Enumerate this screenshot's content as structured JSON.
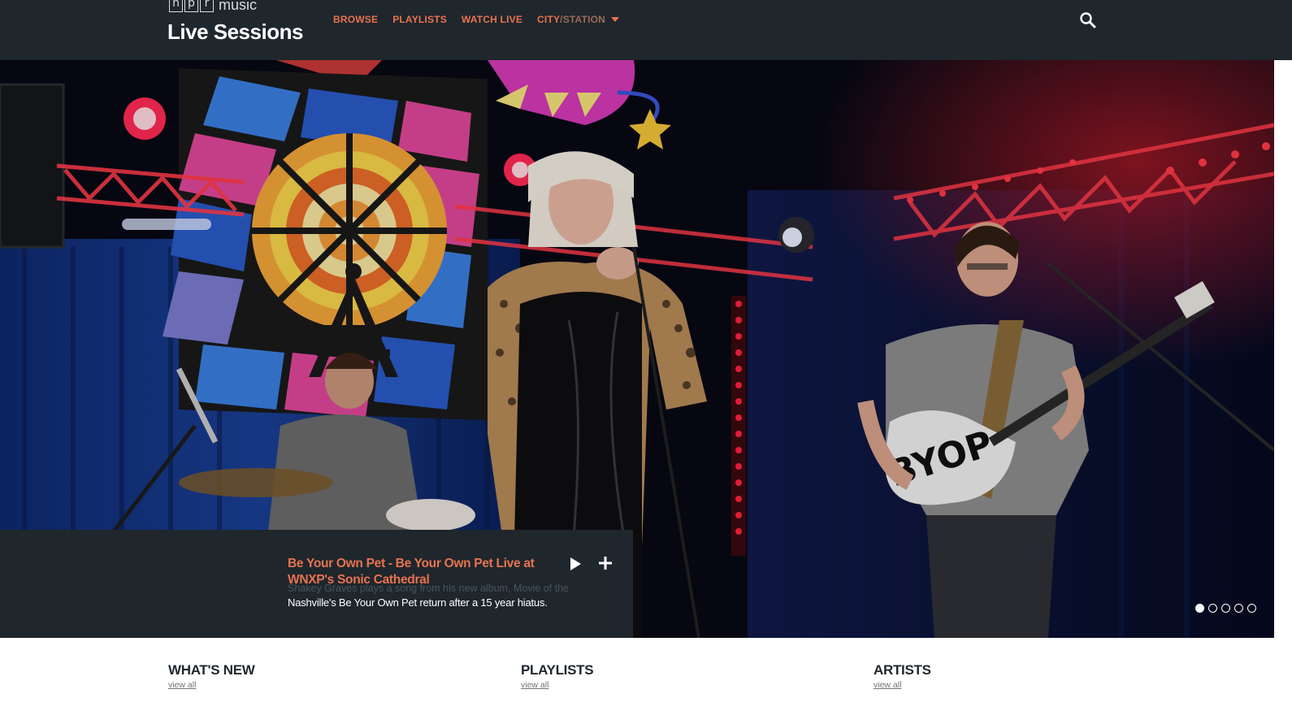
{
  "header": {
    "logo_letters": [
      "n",
      "p",
      "r"
    ],
    "logo_suffix": "music",
    "title": "Live Sessions",
    "nav": [
      {
        "label": "BROWSE"
      },
      {
        "label": "PLAYLISTS"
      },
      {
        "label": "WATCH LIVE"
      }
    ],
    "city_station": {
      "part1": "CITY",
      "sep": "/",
      "part2": "STATION"
    },
    "search_icon": "search-icon"
  },
  "hero": {
    "title": "Be Your Own Pet - Be Your Own Pet Live at WNXP's Sonic Cathedral",
    "ghost_text": "Shakey Graves plays a song from his new album, Movie of the",
    "description": "Nashville's Be Your Own Pet return after a 15 year hiatus.",
    "play_icon": "play-icon",
    "add_icon": "plus-icon",
    "slides_count": 5,
    "active_slide": 1
  },
  "sections": [
    {
      "title": "WHAT'S NEW",
      "link": "view all"
    },
    {
      "title": "PLAYLISTS",
      "link": "view all"
    },
    {
      "title": "ARTISTS",
      "link": "view all"
    }
  ],
  "colors": {
    "header_bg": "#1f262c",
    "accent": "#e8734f",
    "panel_bg": "#1f262c"
  }
}
